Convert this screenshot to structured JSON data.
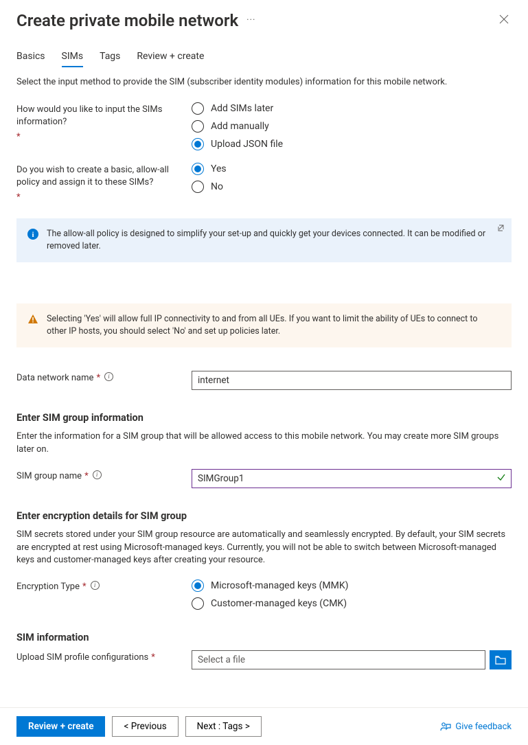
{
  "header": {
    "title": "Create private mobile network"
  },
  "tabs": [
    {
      "label": "Basics"
    },
    {
      "label": "SIMs",
      "active": true
    },
    {
      "label": "Tags"
    },
    {
      "label": "Review + create"
    }
  ],
  "intro": "Select the input method to provide the SIM (subscriber identity modules) information for this mobile network.",
  "q_input_method": {
    "label": "How would you like to input the SIMs information?",
    "options": [
      "Add SIMs later",
      "Add manually",
      "Upload JSON file"
    ],
    "selected": "Upload JSON file"
  },
  "q_allow_all": {
    "label": "Do you wish to create a basic, allow-all policy and assign it to these SIMs?",
    "options": [
      "Yes",
      "No"
    ],
    "selected": "Yes"
  },
  "info_box_blue": "The allow-all policy is designed to simplify your set-up and quickly get your devices connected. It can be modified or removed later.",
  "info_box_orange": "Selecting 'Yes' will allow full IP connectivity to and from all UEs. If you want to limit the ability of UEs to connect to other IP hosts, you should select 'No' and set up policies later.",
  "data_network": {
    "label": "Data network name",
    "value": "internet"
  },
  "sim_group_section": {
    "heading": "Enter SIM group information",
    "desc": "Enter the information for a SIM group that will be allowed access to this mobile network. You may create more SIM groups later on.",
    "name_label": "SIM group name",
    "name_value": "SIMGroup1"
  },
  "encryption_section": {
    "heading": "Enter encryption details for SIM group",
    "desc": "SIM secrets stored under your SIM group resource are automatically and seamlessly encrypted. By default, your SIM secrets are encrypted at rest using Microsoft-managed keys. Currently, you will not be able to switch between Microsoft-managed keys and customer-managed keys after creating your resource.",
    "type_label": "Encryption Type",
    "options": [
      "Microsoft-managed keys (MMK)",
      "Customer-managed keys (CMK)"
    ],
    "selected": "Microsoft-managed keys (MMK)"
  },
  "sim_info_section": {
    "heading": "SIM information",
    "upload_label": "Upload SIM profile configurations",
    "placeholder": "Select a file"
  },
  "footer": {
    "review": "Review + create",
    "previous": "< Previous",
    "next": "Next : Tags >",
    "feedback": "Give feedback"
  }
}
